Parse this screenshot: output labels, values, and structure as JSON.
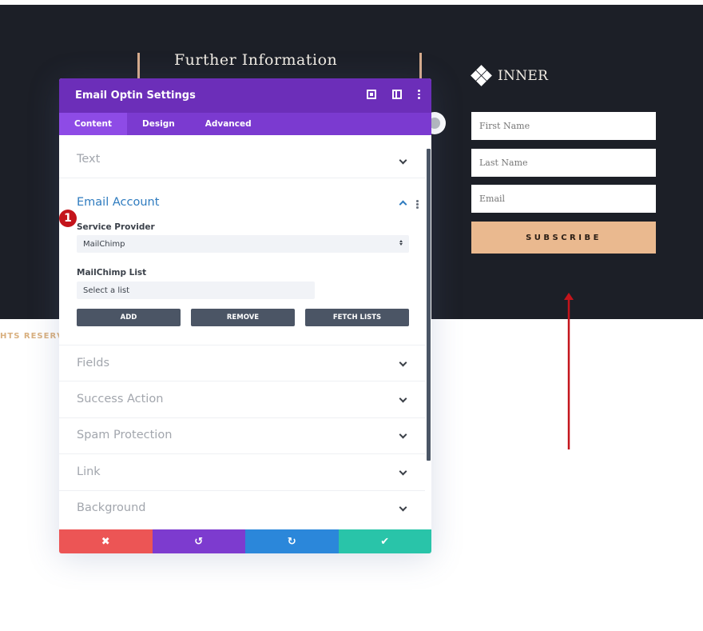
{
  "page": {
    "heading": "Further Information",
    "logo_text": "INNER",
    "form": {
      "first_name_placeholder": "First Name",
      "last_name_placeholder": "Last Name",
      "email_placeholder": "Email",
      "subscribe_label": "SUBSCRIBE"
    },
    "footer_text": "HTS RESERVED"
  },
  "panel": {
    "title": "Email Optin Settings",
    "header_icons": [
      "expand-icon",
      "split-view-icon",
      "more-options-icon"
    ],
    "tabs": [
      {
        "label": "Content",
        "active": true
      },
      {
        "label": "Design",
        "active": false
      },
      {
        "label": "Advanced",
        "active": false
      }
    ],
    "sections": {
      "text": "Text",
      "email_account": "Email Account",
      "fields": "Fields",
      "success_action": "Success Action",
      "spam_protection": "Spam Protection",
      "link": "Link",
      "background": "Background"
    },
    "email_account": {
      "service_provider_label": "Service Provider",
      "service_provider_value": "MailChimp",
      "list_label": "MailChimp List",
      "list_value": "Select a list",
      "buttons": {
        "add": "ADD",
        "remove": "REMOVE",
        "fetch": "FETCH LISTS"
      }
    },
    "footer": {
      "cancel": "✖",
      "undo": "↺",
      "redo": "↻",
      "save": "✔"
    }
  },
  "annotation": {
    "badge_number": "1",
    "colors": {
      "badge": "#c4141b",
      "arrow": "#c4141b"
    }
  },
  "colors": {
    "header": "#6c2eb9",
    "tabs": "#7b3ad0",
    "active_tab": "#8e4be6",
    "dark_bg": "#1c1f27",
    "accent_link": "#2e7bbf",
    "subscribe": "#eab98f",
    "cancel": "#ec5555",
    "undo": "#7d3bcf",
    "redo": "#2b87da",
    "save": "#29c4a9"
  }
}
